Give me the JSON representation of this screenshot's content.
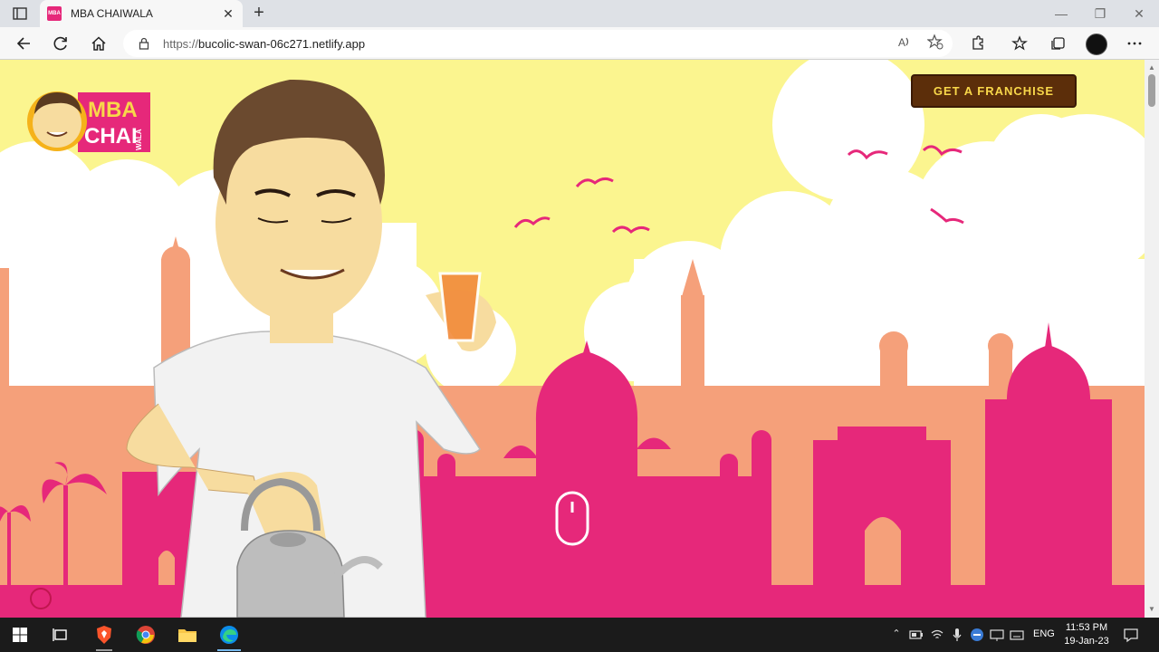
{
  "browser": {
    "tab_title": "MBA CHAIWALA",
    "url_protocol": "https://",
    "url_host": "bucolic-swan-06c271.netlify.app",
    "new_tab_label": "+"
  },
  "page": {
    "franchise_button": "GET A FRANCHISE",
    "logo_text_1": "MBA",
    "logo_text_2": "CHAI",
    "logo_text_3": "WALA",
    "colors": {
      "sky": "#fbf58f",
      "pink": "#e6287a",
      "peach": "#f5a07a",
      "button_bg": "#5c2e0a",
      "button_text": "#f8d74a"
    }
  },
  "taskbar": {
    "language": "ENG",
    "time": "11:53 PM",
    "date": "19-Jan-23"
  }
}
